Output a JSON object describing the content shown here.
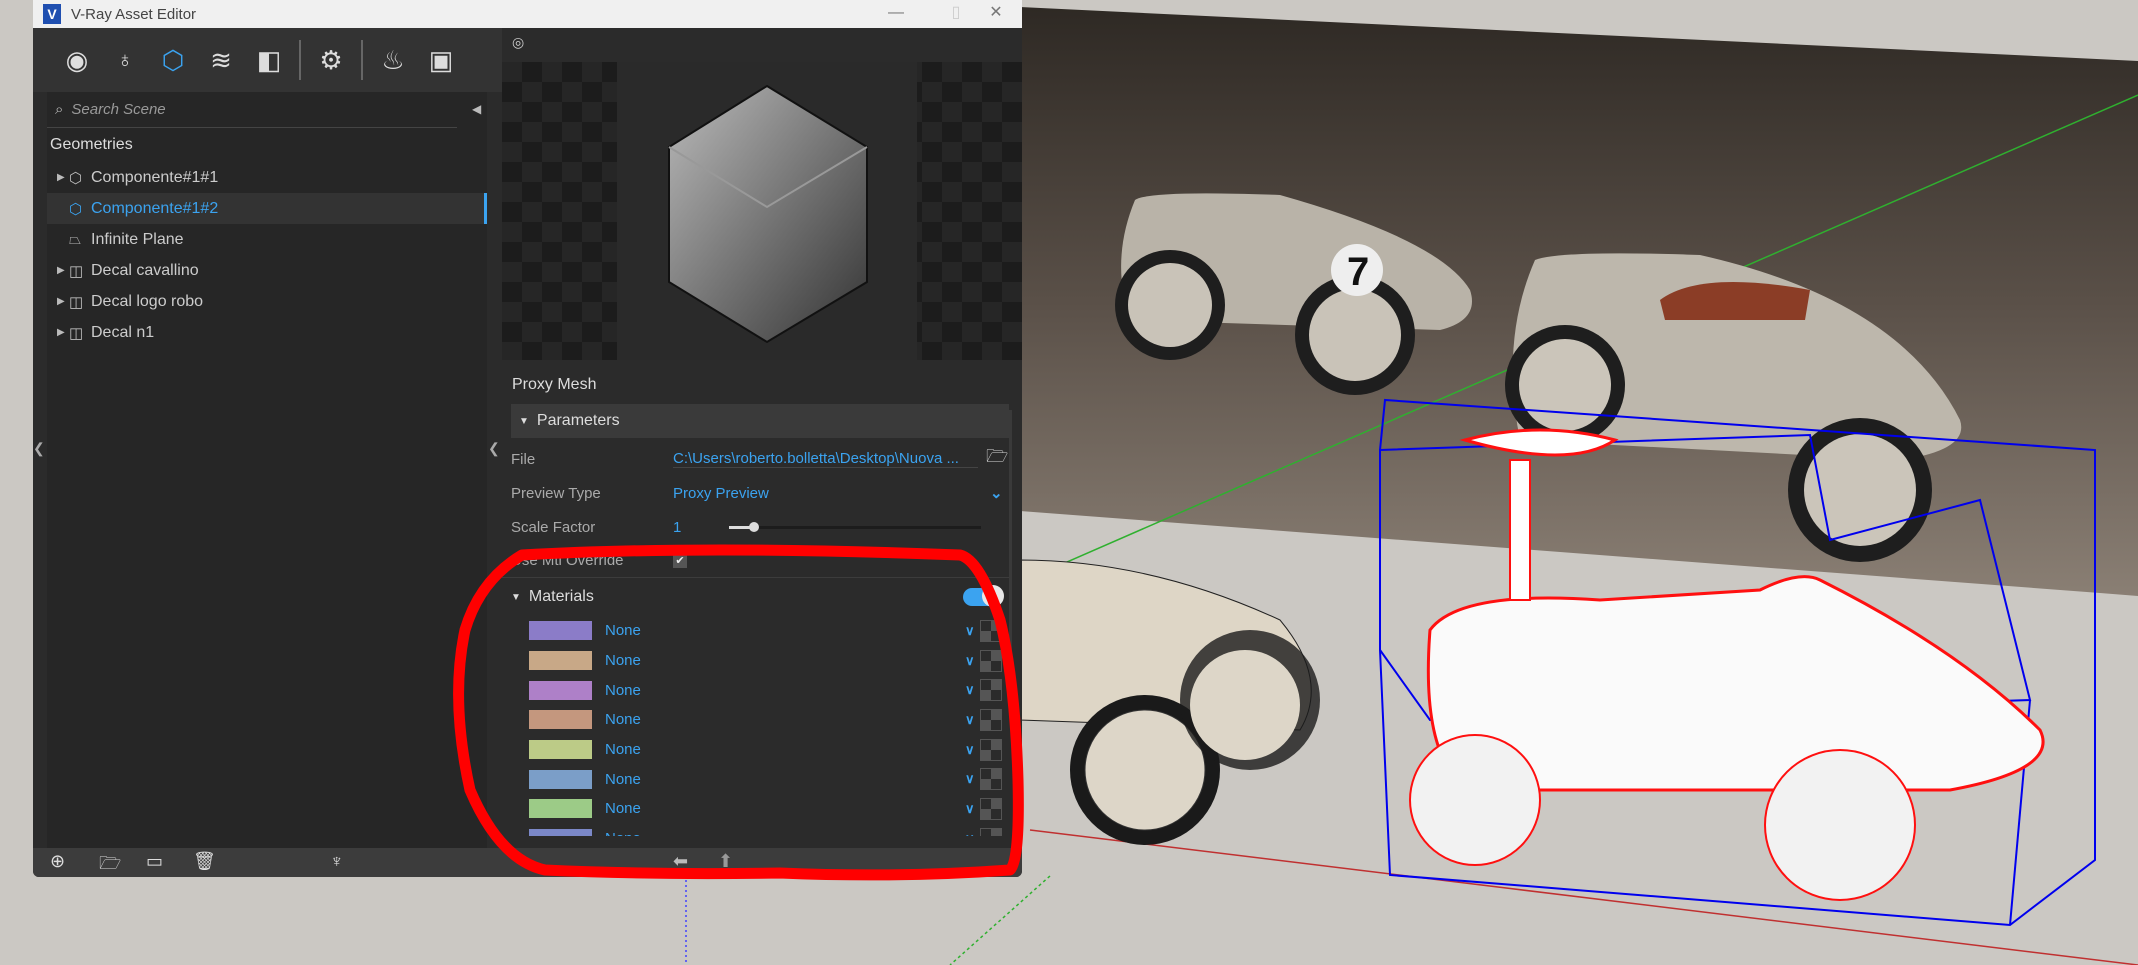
{
  "window": {
    "title": "V-Ray Asset Editor",
    "logo": "V"
  },
  "toolbar": [
    {
      "name": "materials-icon",
      "glyph": "◉"
    },
    {
      "name": "lights-icon",
      "glyph": "💡"
    },
    {
      "name": "geometry-icon",
      "glyph": "⬡"
    },
    {
      "name": "textures-icon",
      "glyph": "◈"
    },
    {
      "name": "render-elements-icon",
      "glyph": "◧"
    },
    {
      "name": "settings-icon",
      "glyph": "⚙"
    },
    {
      "name": "render-teapot-icon",
      "glyph": "☕"
    },
    {
      "name": "frame-buffer-icon",
      "glyph": "▣"
    }
  ],
  "search": {
    "placeholder": "Search Scene"
  },
  "tree": {
    "section": "Geometries",
    "items": [
      {
        "label": "Componente#1#1",
        "expandable": true,
        "icon": "cube-icon"
      },
      {
        "label": "Componente#1#2",
        "expandable": false,
        "icon": "cube-icon",
        "selected": true
      },
      {
        "label": "Infinite Plane",
        "expandable": false,
        "icon": "plane-icon"
      },
      {
        "label": "Decal cavallino",
        "expandable": true,
        "icon": "decal-icon"
      },
      {
        "label": "Decal logo robo",
        "expandable": true,
        "icon": "decal-icon"
      },
      {
        "label": "Decal n1",
        "expandable": true,
        "icon": "decal-icon"
      }
    ]
  },
  "properties": {
    "header": "Proxy Mesh",
    "group": "Parameters",
    "file": {
      "label": "File",
      "value": "C:\\Users\\roberto.bolletta\\Desktop\\Nuova ..."
    },
    "preview_type": {
      "label": "Preview Type",
      "value": "Proxy Preview"
    },
    "scale_factor": {
      "label": "Scale Factor",
      "value": "1",
      "slider_fraction": 0.1
    },
    "mtl_override": {
      "label": "Use Mtl Override",
      "checked": true
    },
    "materials": {
      "label": "Materials",
      "enabled": true,
      "items": [
        {
          "color": "#8b7cc8",
          "value": "None"
        },
        {
          "color": "#c8a887",
          "value": "None"
        },
        {
          "color": "#ae80c8",
          "value": "None"
        },
        {
          "color": "#c4977e",
          "value": "None"
        },
        {
          "color": "#bccb87",
          "value": "None"
        },
        {
          "color": "#7b9ec8",
          "value": "None"
        },
        {
          "color": "#9ccb87",
          "value": "None"
        },
        {
          "color": "#7b88c8",
          "value": "None"
        }
      ]
    }
  },
  "colors": {
    "accent": "#3ba3f0",
    "annotation": "#ff0000",
    "bounding_box": "#0000ff"
  }
}
